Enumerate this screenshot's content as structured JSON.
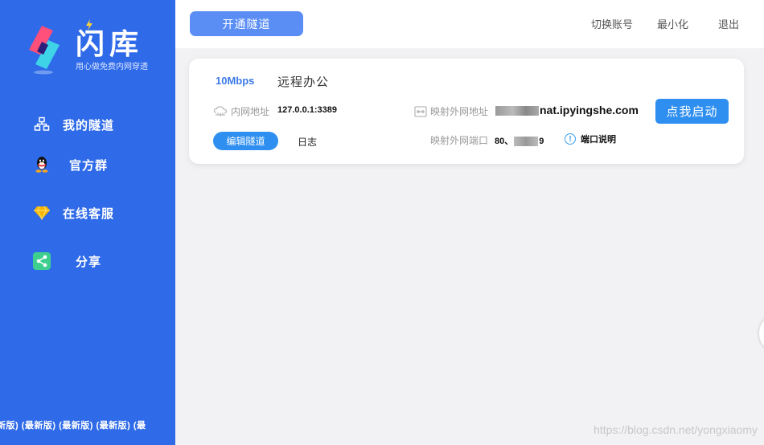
{
  "app": {
    "name": "闪库",
    "slogan": "用心做免费内网穿透"
  },
  "sidebar": {
    "items": [
      {
        "label": "我的隧道",
        "icon": "tunnel-icon"
      },
      {
        "label": "官方群",
        "icon": "qq-icon"
      },
      {
        "label": "在线客服",
        "icon": "diamond-icon"
      },
      {
        "label": "分享",
        "icon": "share-icon"
      }
    ],
    "version_text": "新版) (最新版) (最新版) (最新版) (最"
  },
  "topbar": {
    "open_tunnel": "开通隧道",
    "switch_account": "切换账号",
    "minimize": "最小化",
    "exit": "退出"
  },
  "tunnel": {
    "bandwidth": "10Mbps",
    "name": "远程办公",
    "local_label": "内网地址",
    "local_value": "127.0.0.1:3389",
    "public_label": "映射外网地址",
    "public_domain": "nat.ipyingshe.com",
    "port_label": "映射外网端口",
    "port_prefix": "80、",
    "port_suffix": "9",
    "start": "点我启动",
    "edit": "编辑隧道",
    "log": "日志",
    "port_help": "端口说明"
  },
  "watermark": "https://blog.csdn.net/yongxiaomy",
  "colors": {
    "sidebar": "#2f6ae8",
    "primary_button": "#2f8ff0",
    "open_button": "#5b8ef5",
    "bandwidth": "#3c7be6"
  }
}
